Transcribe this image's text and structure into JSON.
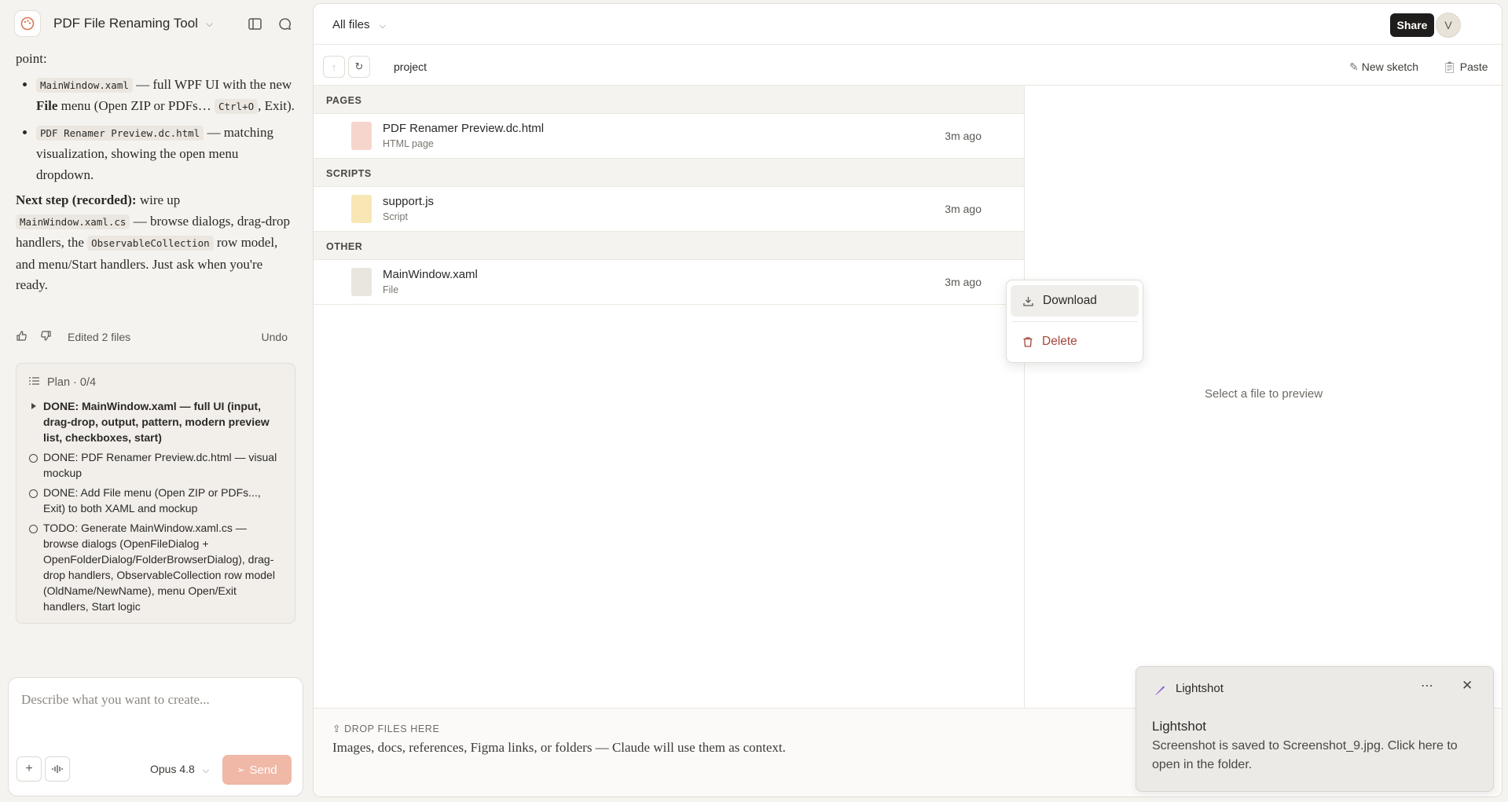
{
  "left": {
    "title": "PDF File Renaming Tool",
    "chat": {
      "intro": "point:",
      "bullets": [
        {
          "code": "MainWindow.xaml",
          "text_a": " — full WPF UI with the new ",
          "bold": "File",
          "text_b": " menu (Open ZIP or PDFs… ",
          "code2": "Ctrl+O",
          "text_c": ", Exit)."
        },
        {
          "code": "PDF Renamer Preview.dc.html",
          "text_a": " — matching visualization, showing the open menu dropdown."
        }
      ],
      "next_bold": "Next step (recorded):",
      "next_a": " wire up ",
      "next_code1": "MainWindow.xaml.cs",
      "next_b": " — browse dialogs, drag-drop handlers, the ",
      "next_code2": "ObservableCollection",
      "next_c": " row model, and menu/Start handlers. Just ask when you're ready."
    },
    "actions": {
      "edited": "Edited 2 files",
      "undo": "Undo"
    },
    "plan": {
      "title": "Plan · 0/4",
      "items": [
        "DONE: MainWindow.xaml — full UI (input, drag-drop, output, pattern, modern preview list, checkboxes, start)",
        "DONE: PDF Renamer Preview.dc.html — visual mockup",
        "DONE: Add File menu (Open ZIP or PDFs..., Exit) to both XAML and mockup",
        "TODO: Generate MainWindow.xaml.cs — browse dialogs (OpenFileDialog + OpenFolderDialog/FolderBrowserDialog), drag-drop handlers, ObservableCollection row model (OldName/NewName), menu Open/Exit handlers, Start logic"
      ]
    },
    "composer": {
      "placeholder": "Describe what you want to create...",
      "model": "Opus 4.8",
      "send": "Send"
    }
  },
  "main": {
    "filter": "All files",
    "share": "Share",
    "avatar": "V",
    "breadcrumb": "project",
    "new_sketch": "New sketch",
    "paste": "Paste",
    "sections": [
      {
        "label": "PAGES",
        "files": [
          {
            "name": "PDF Renamer Preview.dc.html",
            "type": "HTML page",
            "time": "3m ago"
          }
        ]
      },
      {
        "label": "SCRIPTS",
        "files": [
          {
            "name": "support.js",
            "type": "Script",
            "time": "3m ago"
          }
        ]
      },
      {
        "label": "OTHER",
        "files": [
          {
            "name": "MainWindow.xaml",
            "type": "File",
            "time": "3m ago"
          }
        ]
      }
    ],
    "preview_text": "Select a file to preview",
    "drop_label": "DROP FILES HERE",
    "drop_text": "Images, docs, references, Figma links, or folders — Claude will use them as context."
  },
  "context_menu": {
    "download": "Download",
    "delete": "Delete"
  },
  "toast": {
    "app": "Lightshot",
    "title": "Lightshot",
    "body": "Screenshot is saved to Screenshot_9.jpg. Click here to open in the folder."
  },
  "colors": {
    "accent": "#d97757",
    "send_disabled": "#f0b8a6",
    "delete": "#a6463a"
  }
}
